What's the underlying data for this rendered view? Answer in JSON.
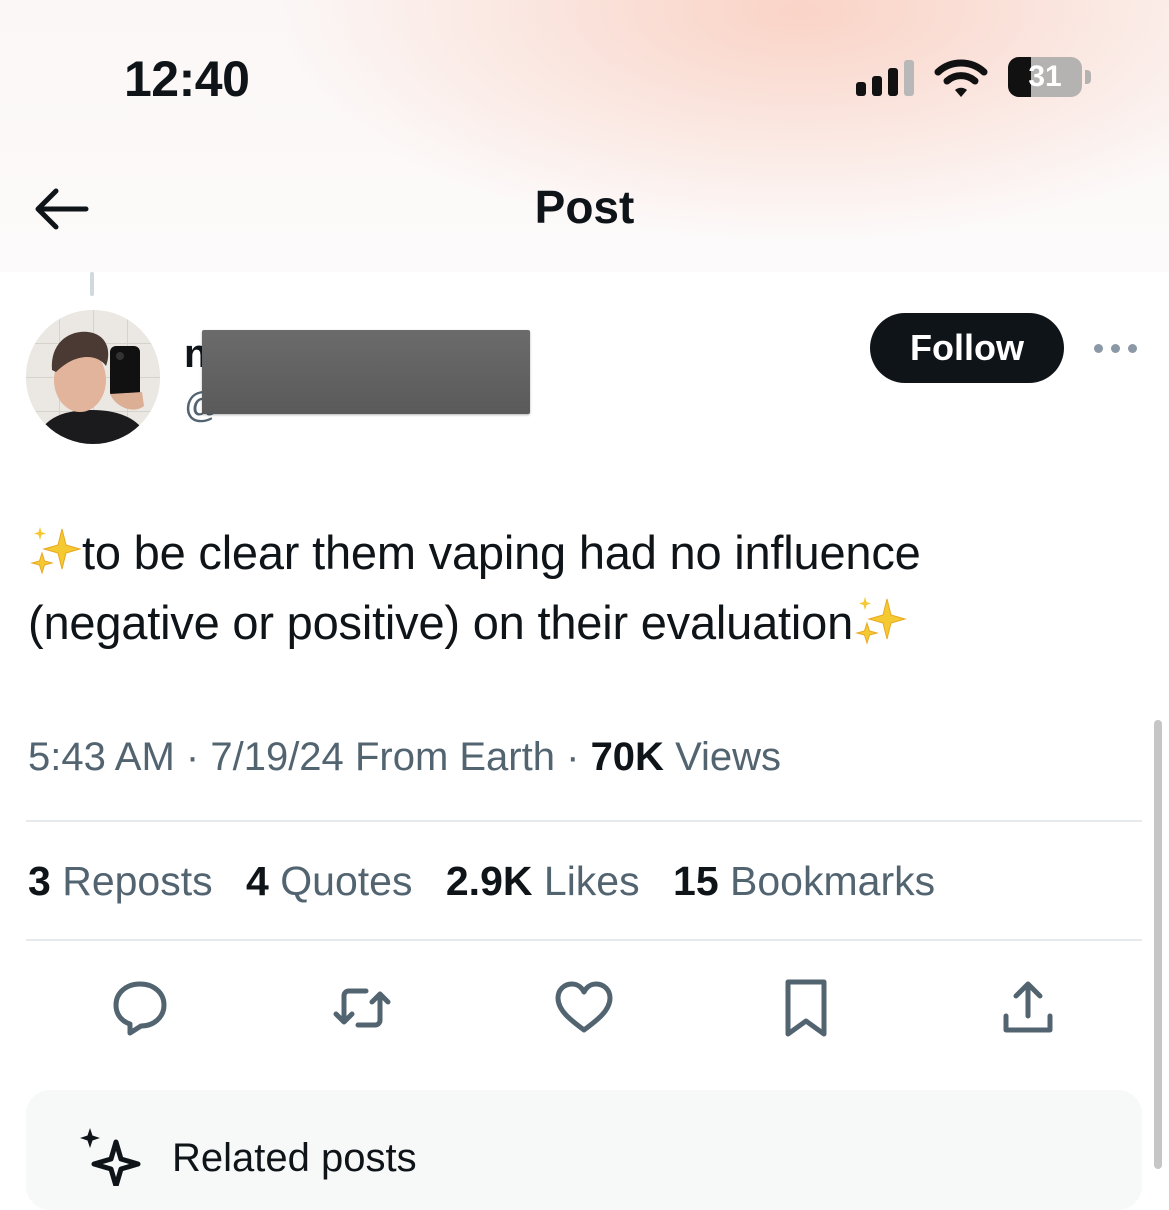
{
  "status_bar": {
    "time": "12:40",
    "battery_text": "31",
    "battery_level_percent": 31,
    "signal_bars_active": 3,
    "signal_bars_total": 4
  },
  "header": {
    "title": "Post",
    "back_icon": "arrow-left-icon"
  },
  "author": {
    "name_visible": "n",
    "handle_visible": "@",
    "follow_label": "Follow",
    "more_icon": "ellipsis-icon"
  },
  "post": {
    "text_line1": "to be clear them vaping had no influence",
    "text_line2": "(negative or positive) on their evaluation",
    "emoji": "sparkles-icon"
  },
  "meta": {
    "time": "5:43 AM",
    "date": "7/19/24",
    "source": "From Earth",
    "views_count": "70K",
    "views_label": "Views",
    "separator": "·"
  },
  "stats": {
    "reposts_count": "3",
    "reposts_label": "Reposts",
    "quotes_count": "4",
    "quotes_label": "Quotes",
    "likes_count": "2.9K",
    "likes_label": "Likes",
    "bookmarks_count": "15",
    "bookmarks_label": "Bookmarks"
  },
  "actions": [
    "reply-icon",
    "repost-icon",
    "like-icon",
    "bookmark-icon",
    "share-icon"
  ],
  "related": {
    "label": "Related posts",
    "icon": "sparkles-icon"
  },
  "colors": {
    "text_primary": "#0f1419",
    "text_secondary": "#536471",
    "follow_bg": "#0f1419",
    "follow_text": "#ffffff",
    "divider": "#e6eaed",
    "sparkle": "#f5c932"
  }
}
